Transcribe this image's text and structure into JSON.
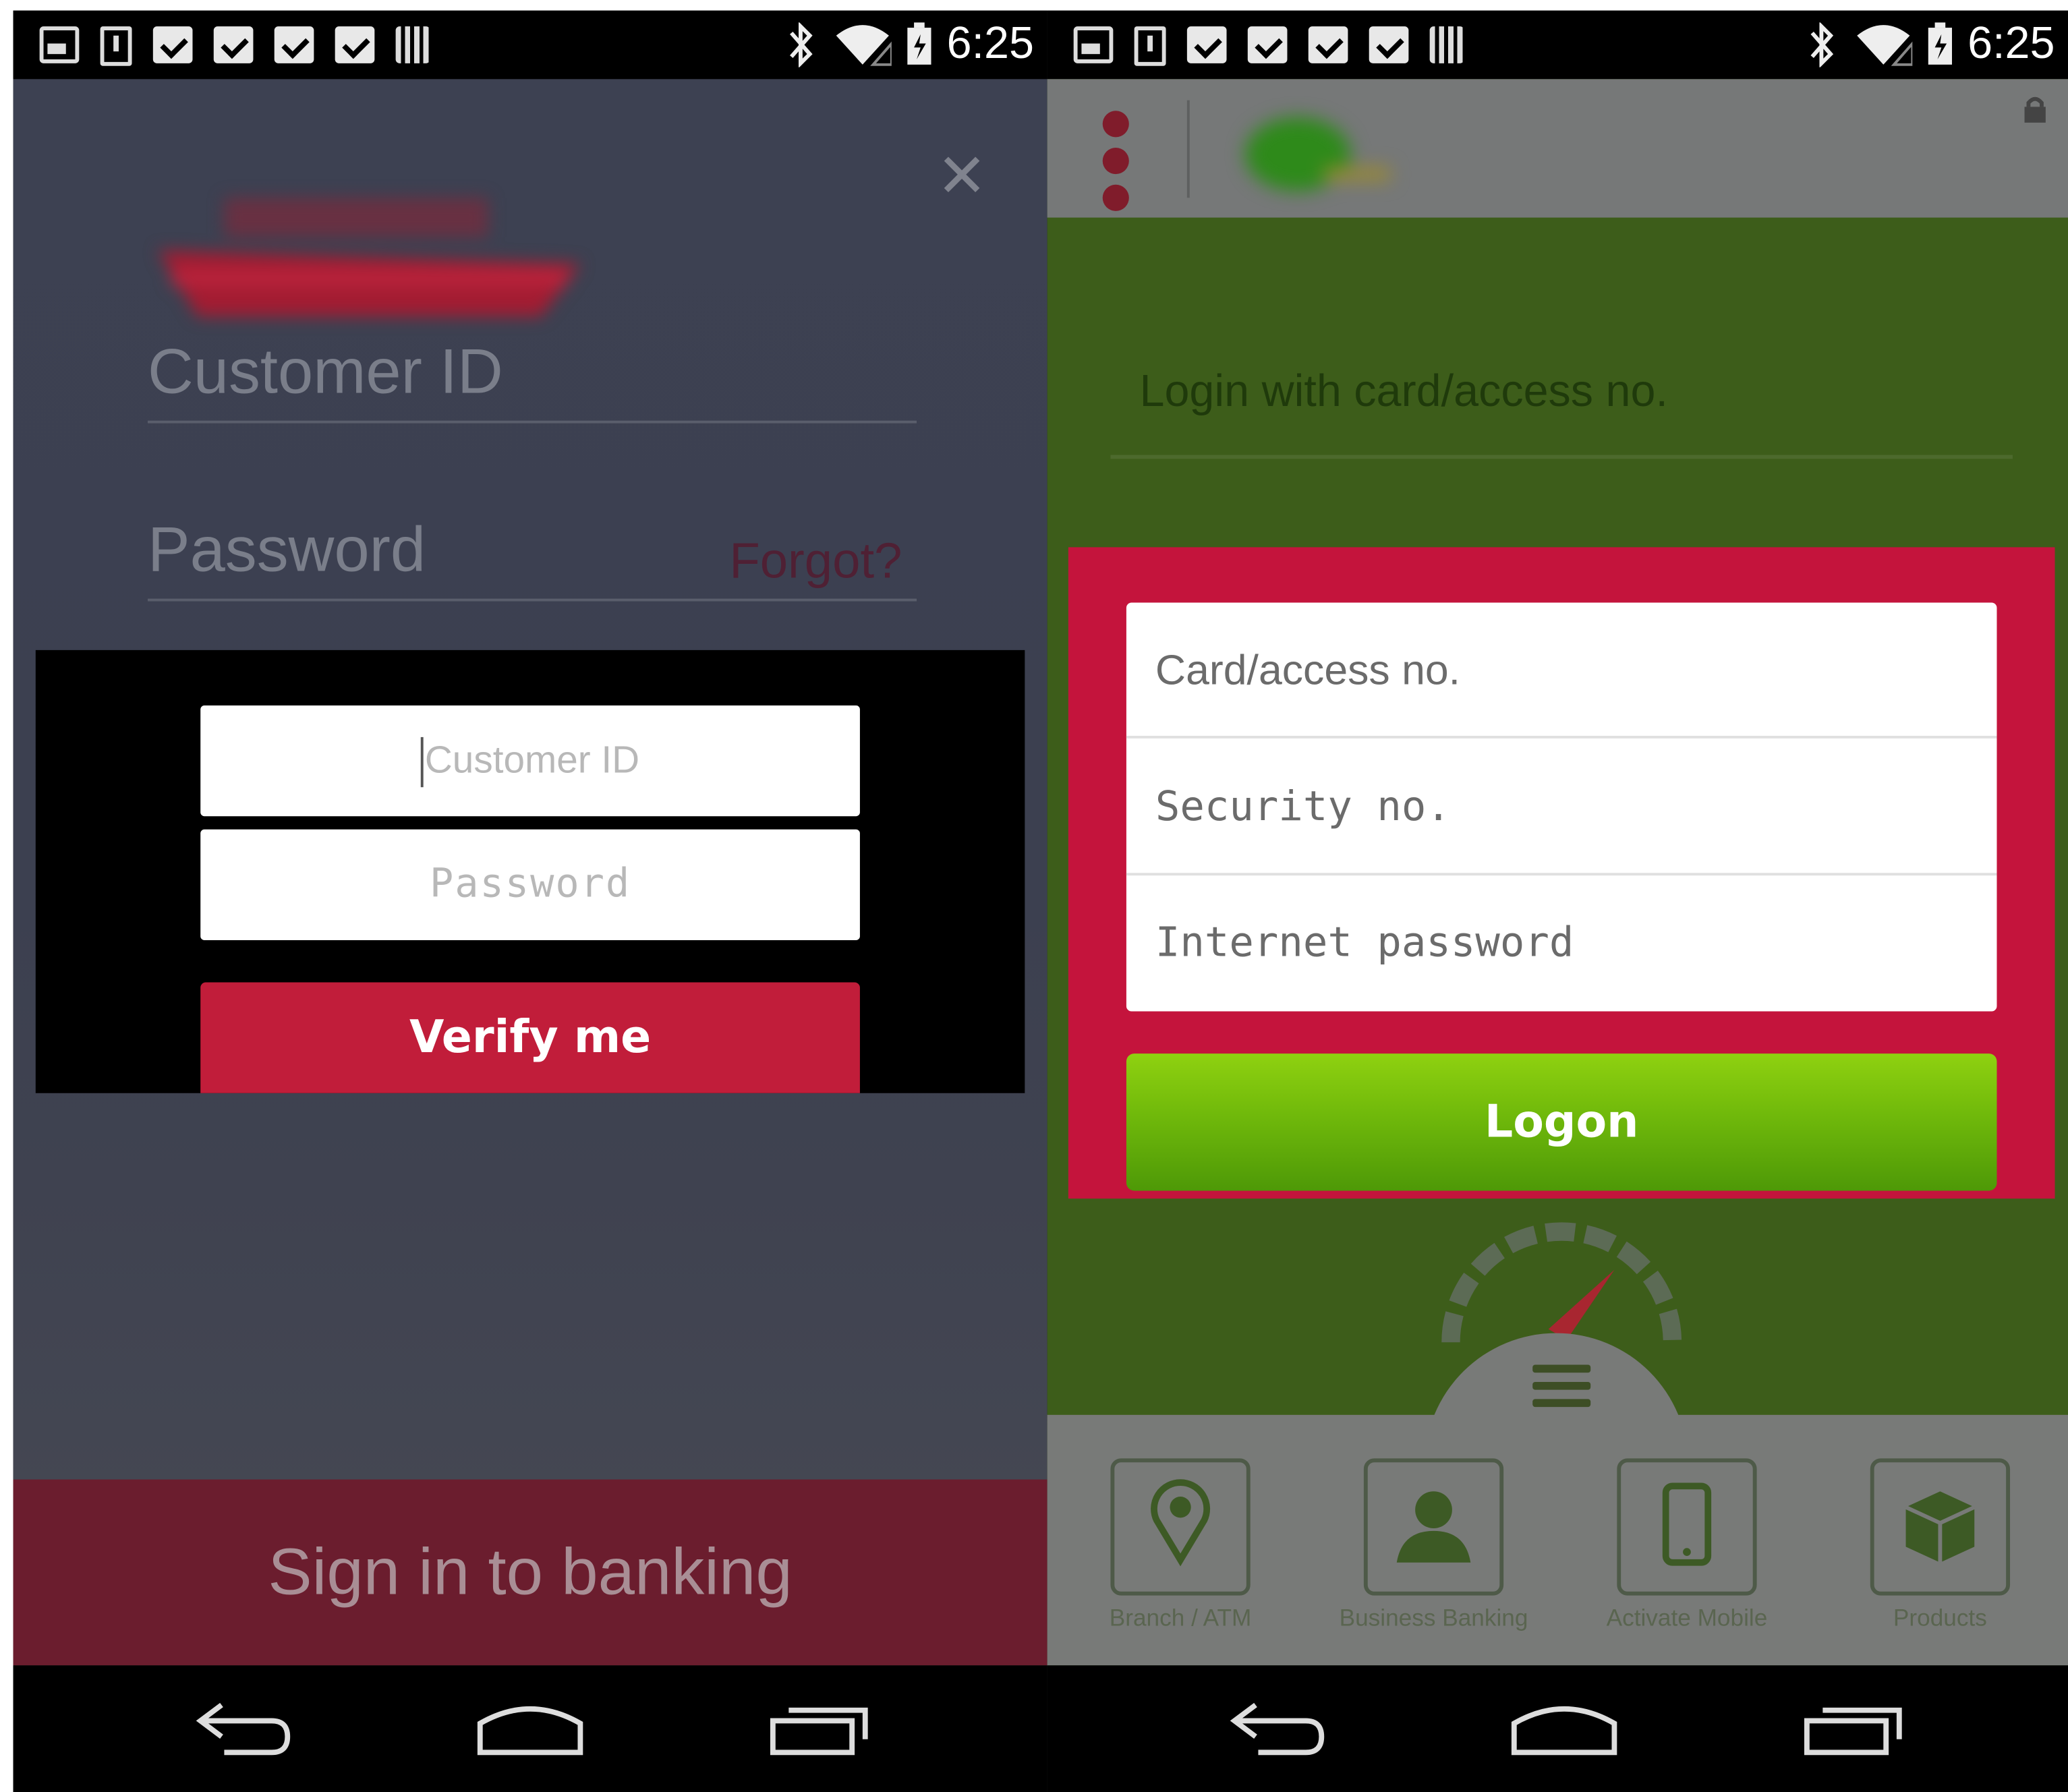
{
  "status_bar": {
    "time": "6:25"
  },
  "left_screen": {
    "background_fields": {
      "customer_id_placeholder": "Customer ID",
      "password_placeholder": "Password",
      "forgot_link": "Forgot?"
    },
    "dialog": {
      "customer_id_placeholder": "Customer ID",
      "password_placeholder": "Password",
      "verify_button": "Verify me"
    },
    "sign_in_bar": "Sign in to banking"
  },
  "right_screen": {
    "login_heading": "Login with card/access no.",
    "dialog": {
      "card_placeholder": "Card/access no.",
      "security_placeholder": "Security no.",
      "internet_password_placeholder": "Internet password",
      "logon_button": "Logon"
    },
    "bottom_nav": [
      {
        "label": "Branch / ATM",
        "icon": "location-pin-icon"
      },
      {
        "label": "Business Banking",
        "icon": "person-icon"
      },
      {
        "label": "Activate Mobile",
        "icon": "mobile-phone-icon"
      },
      {
        "label": "Products",
        "icon": "box-icon"
      }
    ]
  },
  "colors": {
    "left_accent": "#c11d3a",
    "right_dialog": "#c4143c",
    "right_logon": "#70b90b"
  }
}
